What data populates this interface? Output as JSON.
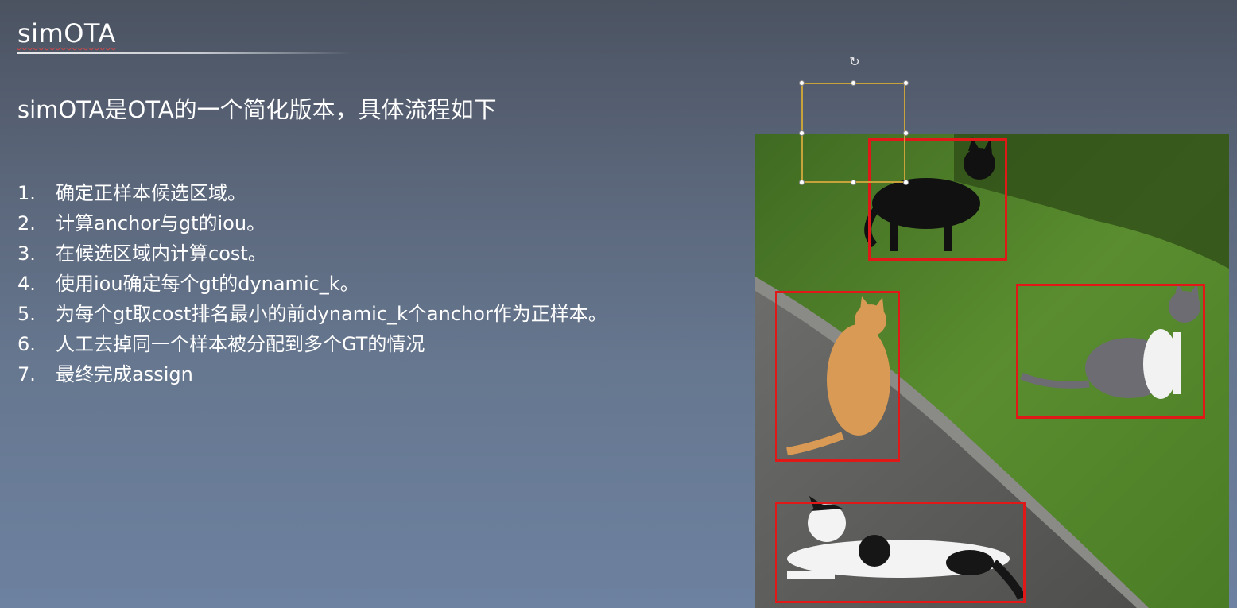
{
  "slide": {
    "title": "simOTA",
    "subtitle": "simOTA是OTA的一个简化版本，具体流程如下",
    "steps": [
      {
        "num": "1.",
        "text": "确定正样本候选区域。"
      },
      {
        "num": "2.",
        "text": "计算anchor与gt的iou。"
      },
      {
        "num": "3.",
        "text": "在候选区域内计算cost。"
      },
      {
        "num": "4.",
        "text": "使用iou确定每个gt的dynamic_k。"
      },
      {
        "num": "5.",
        "text": "为每个gt取cost排名最小的前dynamic_k个anchor作为正样本。"
      },
      {
        "num": "6.",
        "text": "人工去掉同一个样本被分配到多个GT的情况"
      },
      {
        "num": "7.",
        "text": "最终完成assign"
      }
    ]
  },
  "image": {
    "subject": "four cats on grass and path with red detection boxes",
    "detections": [
      "black-cat",
      "orange-cat",
      "gray-white-cat",
      "lying-white-black-cat"
    ],
    "box_color": "#e01818"
  },
  "selection": {
    "frame_color": "#c8a23a",
    "rotate_icon": "rotate-icon"
  },
  "colors": {
    "background_top": "#4b5361",
    "background_bottom": "#6d81a0",
    "text": "#ffffff"
  }
}
